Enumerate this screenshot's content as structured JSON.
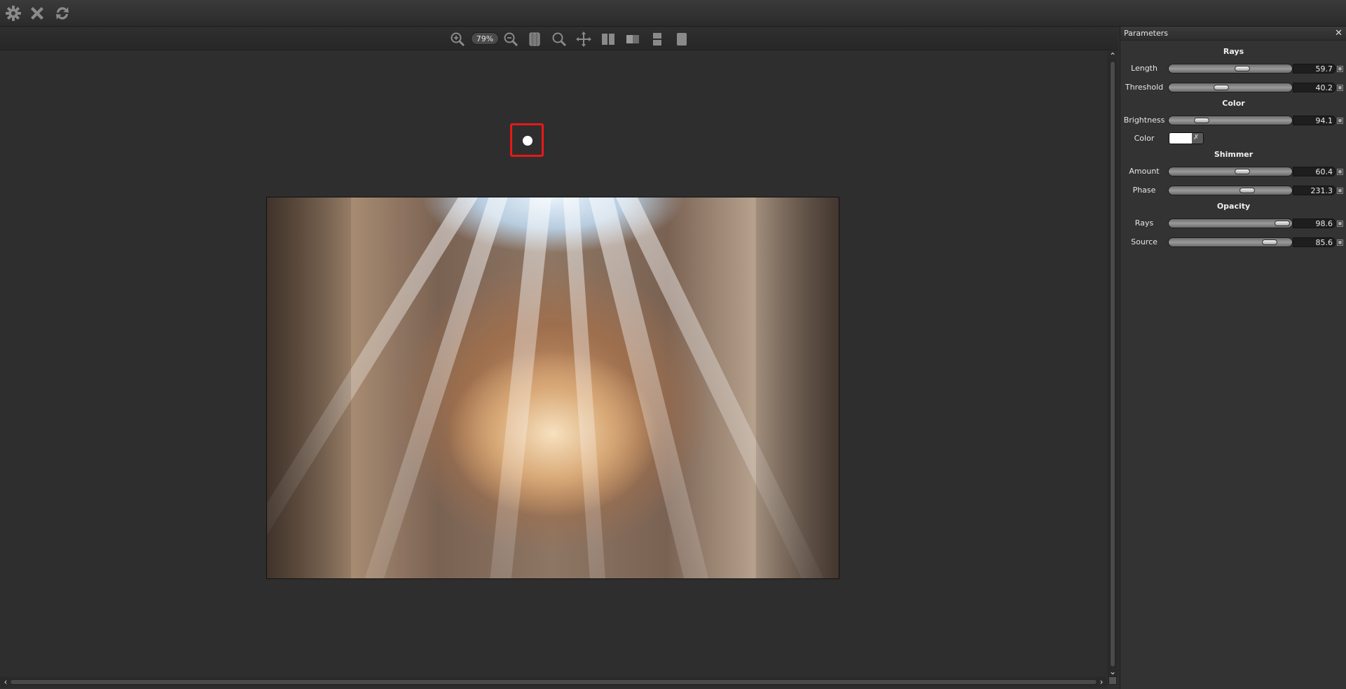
{
  "viewer": {
    "zoom_label": "79%"
  },
  "panel": {
    "title": "Parameters",
    "sections": {
      "rays": "Rays",
      "color": "Color",
      "shimmer": "Shimmer",
      "opacity": "Opacity"
    },
    "params": [
      {
        "label": "Length",
        "value": "59.7",
        "fraction": 0.6
      },
      {
        "label": "Threshold",
        "value": "40.2",
        "fraction": 0.4
      },
      {
        "label": "Brightness",
        "value": "94.1",
        "fraction": 0.22
      },
      {
        "label": "Amount",
        "value": "60.4",
        "fraction": 0.6
      },
      {
        "label": "Phase",
        "value": "231.3",
        "fraction": 0.64
      },
      {
        "label": "Rays",
        "value": "98.6",
        "fraction": 0.97
      },
      {
        "label": "Source",
        "value": "85.6",
        "fraction": 0.85
      }
    ],
    "color_label": "Color",
    "color_value": "#ffffff"
  },
  "icons": {
    "settings": "gear-icon",
    "close": "close-icon",
    "refresh": "refresh-icon",
    "zoom_in": "zoom-in-icon",
    "zoom_out": "zoom-out-icon",
    "fit": "fit-icon",
    "zoom_actual": "magnifier-icon",
    "pan": "pan-icon",
    "split_vertical": "split-vertical-icon",
    "split_left": "split-half-icon",
    "split_horizontal": "split-horizontal-icon",
    "single": "single-view-icon"
  },
  "colors": {
    "source_marker": "#e81818",
    "accent_bg": "#2e2e2e"
  }
}
